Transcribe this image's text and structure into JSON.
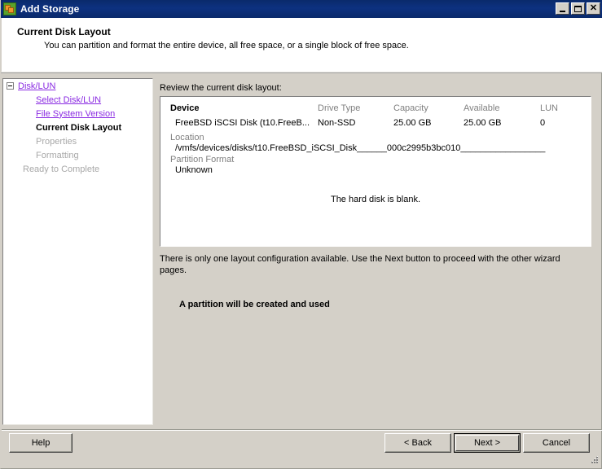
{
  "window": {
    "title": "Add Storage",
    "icon": "add-storage-icon",
    "minimize_label": "–",
    "maximize_label": "□",
    "close_label": "✕"
  },
  "header": {
    "title": "Current Disk Layout",
    "subtitle": "You can partition and format the entire device, all free space, or a single block of free space."
  },
  "sidebar": {
    "items": [
      {
        "label": "Disk/LUN",
        "state": "link",
        "indent": 0,
        "expander": true
      },
      {
        "label": "Select Disk/LUN",
        "state": "link",
        "indent": 1,
        "expander": false
      },
      {
        "label": "File System Version",
        "state": "link",
        "indent": 1,
        "expander": false
      },
      {
        "label": "Current Disk Layout",
        "state": "current",
        "indent": 1,
        "expander": false
      },
      {
        "label": "Properties",
        "state": "disabled",
        "indent": 1,
        "expander": false
      },
      {
        "label": "Formatting",
        "state": "disabled",
        "indent": 1,
        "expander": false
      },
      {
        "label": "Ready to Complete",
        "state": "disabled",
        "indent": 2,
        "expander": false
      }
    ]
  },
  "main": {
    "review_label": "Review the current disk layout:",
    "table": {
      "headers": {
        "device": "Device",
        "drive_type": "Drive Type",
        "capacity": "Capacity",
        "available": "Available",
        "lun": "LUN"
      },
      "row": {
        "device": "FreeBSD iSCSI Disk (t10.FreeB...",
        "drive_type": "Non-SSD",
        "capacity": "25.00 GB",
        "available": "25.00 GB",
        "lun": "0"
      }
    },
    "location_label": "Location",
    "location_value": "/vmfs/devices/disks/t10.FreeBSD_iSCSI_Disk______000c2995b3bc010_________________",
    "partition_format_label": "Partition Format",
    "partition_format_value": "Unknown",
    "blank_message": "The hard disk is blank.",
    "hint": "There is only one layout configuration available. Use the Next button to proceed with the other wizard pages.",
    "partition_note": "A partition will be created and used"
  },
  "footer": {
    "help": "Help",
    "back": "< Back",
    "next": "Next >",
    "cancel": "Cancel"
  },
  "colors": {
    "titlebar": "#0d3180",
    "face": "#d4d0c8",
    "link": "#8a2be2",
    "disabled_text": "#a8a8a8",
    "header_text_muted": "#808080"
  }
}
